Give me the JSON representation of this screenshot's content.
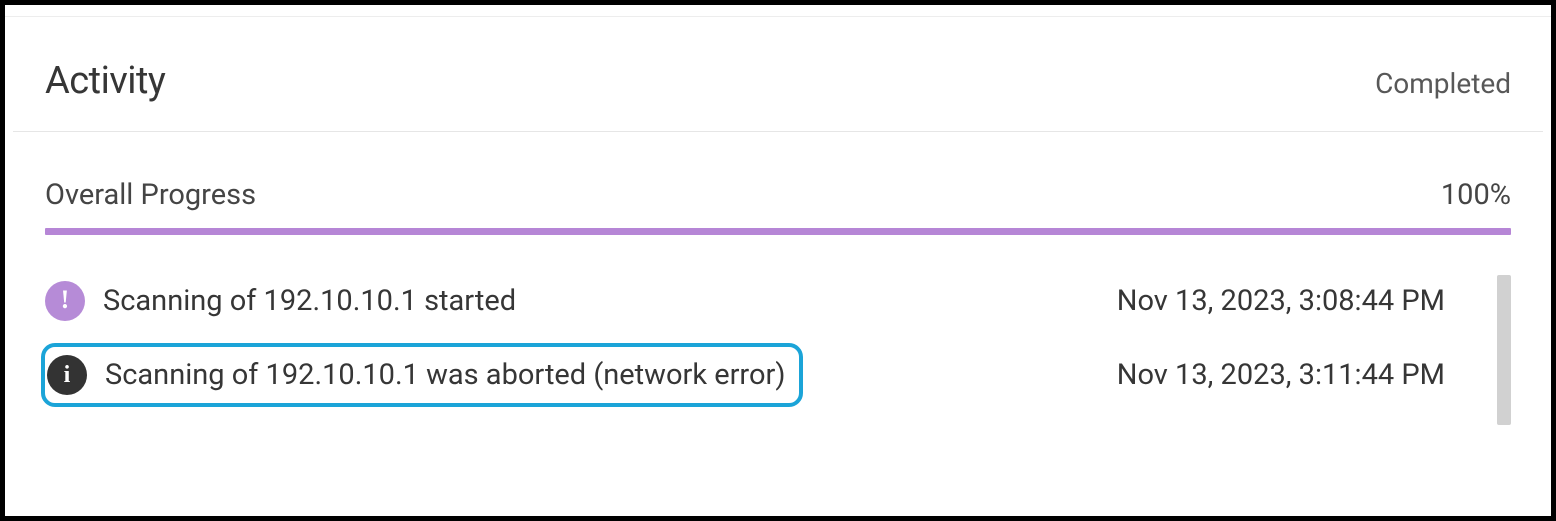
{
  "header": {
    "title": "Activity",
    "status": "Completed"
  },
  "progress": {
    "label": "Overall Progress",
    "percent": "100%",
    "bar_color": "#b686d6"
  },
  "events": [
    {
      "icon": "exclamation-icon",
      "icon_bg": "purple",
      "message": "Scanning of 192.10.10.1 started",
      "timestamp": "Nov 13, 2023, 3:08:44 PM",
      "highlighted": false
    },
    {
      "icon": "info-icon",
      "icon_bg": "dark",
      "message": "Scanning of 192.10.10.1 was aborted (network error)",
      "timestamp": "Nov 13, 2023, 3:11:44 PM",
      "highlighted": true
    }
  ]
}
